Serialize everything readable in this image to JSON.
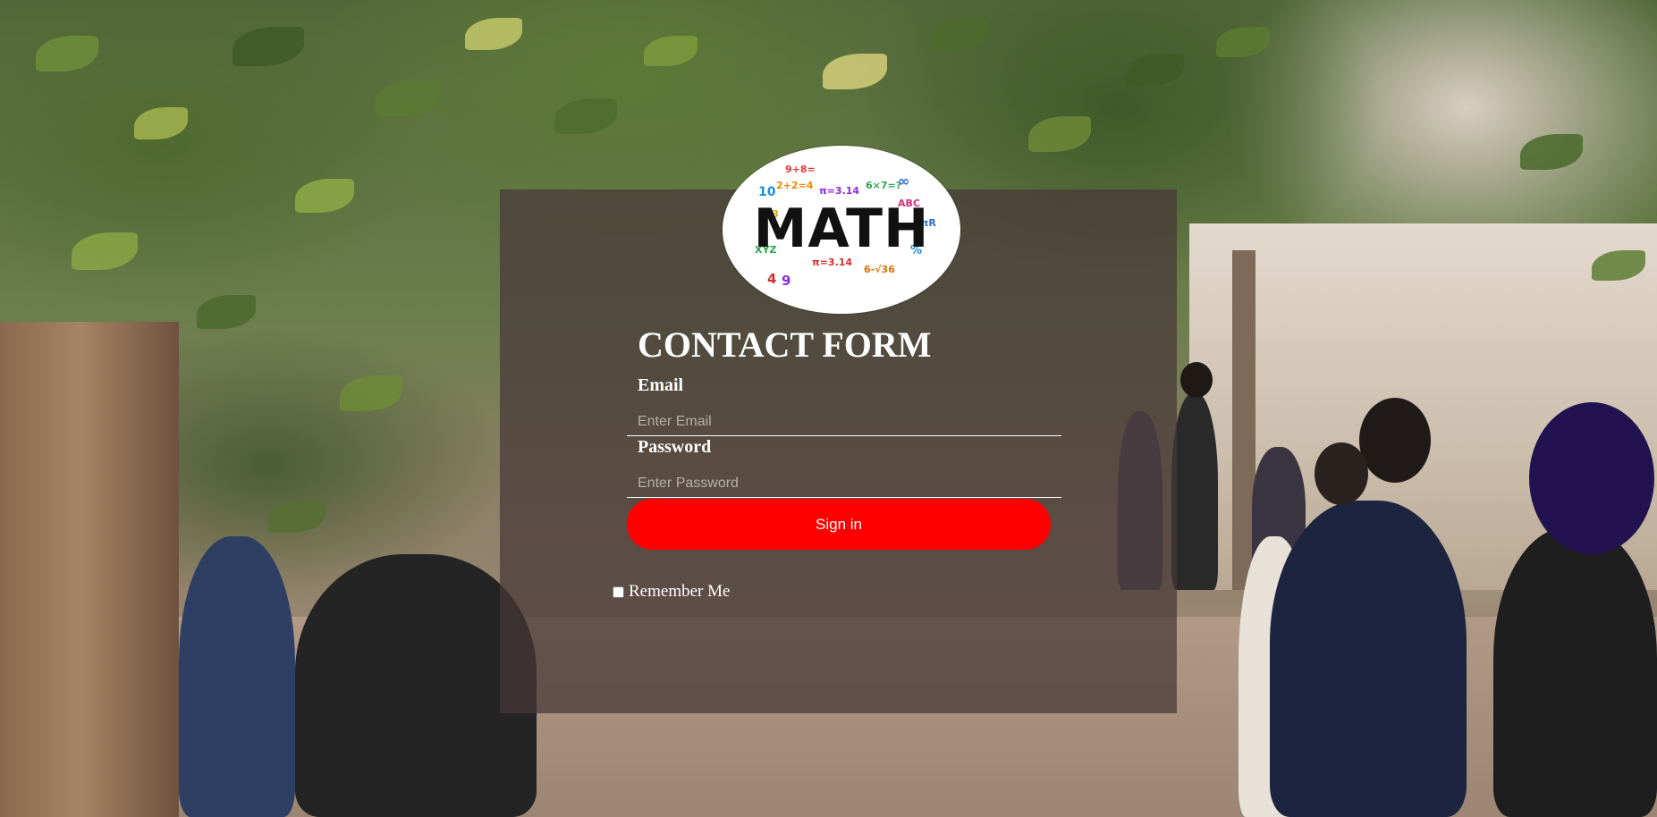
{
  "logo": {
    "text": "MATH",
    "decor": [
      "9+8=",
      "10",
      "2+2=4",
      "π=3.14",
      "6×7=?",
      "ABC",
      "123",
      "2πR",
      "∞",
      "4",
      "9",
      "6-√36",
      "XYZ",
      "π=3.14",
      "%"
    ]
  },
  "form": {
    "title": "CONTACT FORM",
    "email": {
      "label": "Email",
      "placeholder": "Enter Email",
      "value": ""
    },
    "password": {
      "label": "Password",
      "placeholder": "Enter Password",
      "value": ""
    },
    "signin_label": "Sign in",
    "remember": {
      "label": "Remember Me",
      "checked": false
    }
  },
  "colors": {
    "panel": "#463737",
    "button": "#ff0000",
    "text": "#ffffff"
  }
}
